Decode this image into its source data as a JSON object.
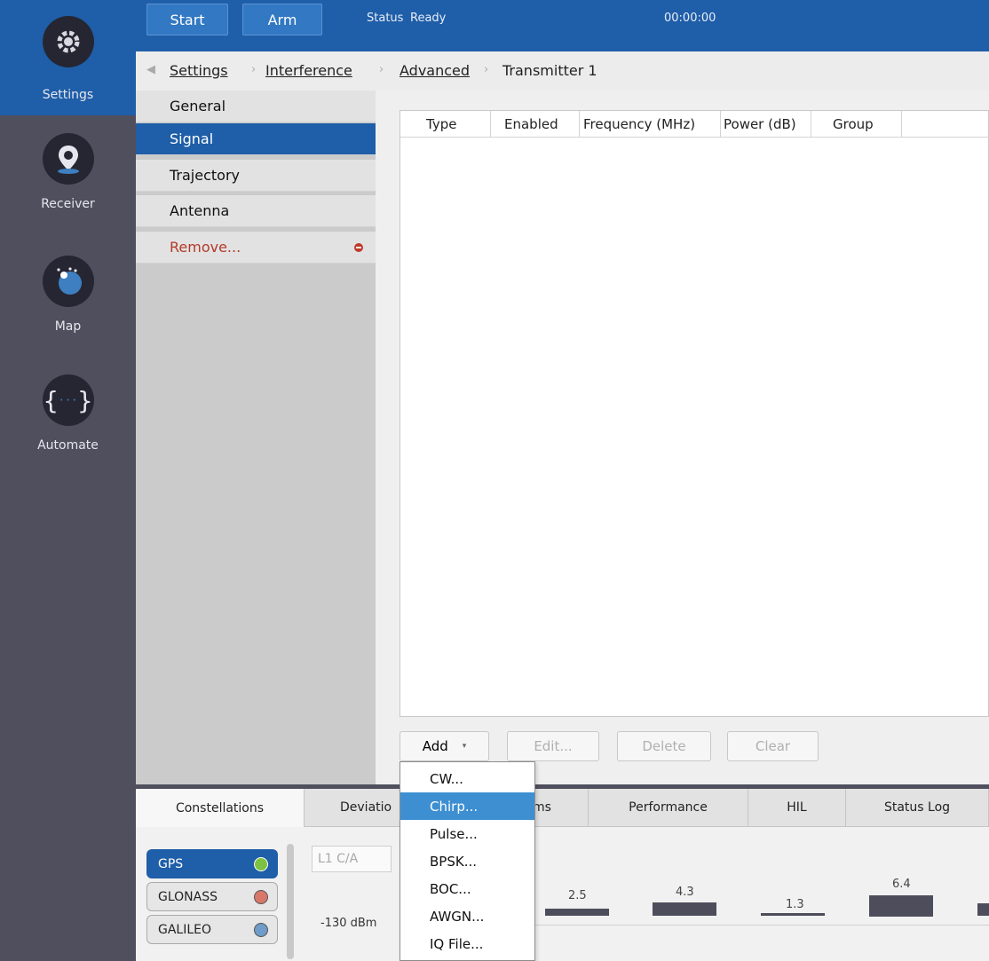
{
  "rail": {
    "items": [
      {
        "label": "Settings",
        "icon": "gear-icon"
      },
      {
        "label": "Receiver",
        "icon": "map-pin-icon"
      },
      {
        "label": "Map",
        "icon": "globe-icon"
      },
      {
        "label": "Automate",
        "icon": "braces-icon"
      }
    ]
  },
  "topbar": {
    "start_label": "Start",
    "arm_label": "Arm",
    "status_label": "Status",
    "status_value": "Ready",
    "timer": "00:00:00"
  },
  "breadcrumb": {
    "items": [
      "Settings",
      "Interference",
      "Advanced",
      "Transmitter 1"
    ]
  },
  "sidemenu": {
    "items": [
      "General",
      "Signal",
      "Trajectory",
      "Antenna",
      "Remove..."
    ],
    "active_index": 1
  },
  "table": {
    "columns": [
      "Type",
      "Enabled",
      "Frequency (MHz)",
      "Power (dB)",
      "Group"
    ],
    "rows": []
  },
  "actions": {
    "add_label": "Add",
    "edit_label": "Edit...",
    "delete_label": "Delete",
    "clear_label": "Clear"
  },
  "dropdown": {
    "items": [
      "CW...",
      "Chirp...",
      "Pulse...",
      "BPSK...",
      "BOC...",
      "AWGN...",
      "IQ File..."
    ],
    "highlighted_index": 1
  },
  "bottom": {
    "tabs": [
      "Constellations",
      "Deviatio",
      "ms",
      "Performance",
      "HIL",
      "Status Log"
    ],
    "active_tab": 0,
    "constellations": [
      {
        "label": "GPS",
        "color": "#7dc242"
      },
      {
        "label": "GLONASS",
        "color": "#d9786a"
      },
      {
        "label": "GALILEO",
        "color": "#6f9cc8"
      }
    ],
    "signal_select": "L1 C/A",
    "power_label": "-130 dBm",
    "bar_values": [
      "2.5",
      "4.3",
      "1.3",
      "6.4"
    ]
  },
  "colors": {
    "accent": "#1f5ea8",
    "rail": "#4f4f5e",
    "danger": "#b33a2a"
  }
}
